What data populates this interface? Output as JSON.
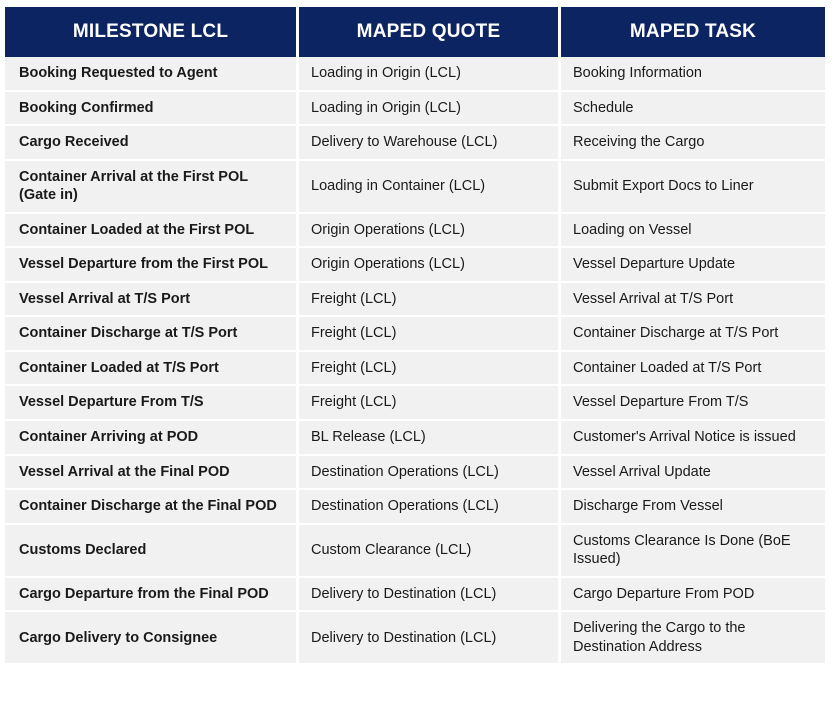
{
  "table": {
    "accent_header_bg": "#0c2461",
    "header_text_color": "#ffffff",
    "row_bg": "#f1f1f1",
    "row_divider_color": "#ffffff",
    "columns": [
      {
        "key": "milestone",
        "label": "MILESTONE LCL"
      },
      {
        "key": "quote",
        "label": "MAPED QUOTE"
      },
      {
        "key": "task",
        "label": "MAPED TASK"
      }
    ],
    "rows": [
      {
        "milestone": "Booking Requested to Agent",
        "quote": "Loading in Origin (LCL)",
        "task": "Booking Information"
      },
      {
        "milestone": "Booking Confirmed",
        "quote": "Loading in Origin (LCL)",
        "task": "Schedule"
      },
      {
        "milestone": "Cargo Received",
        "quote": "Delivery to Warehouse (LCL)",
        "task": "Receiving the Cargo"
      },
      {
        "milestone": "Container Arrival at the First POL (Gate in)",
        "quote": "Loading in Container (LCL)",
        "task": "Submit Export Docs to Liner"
      },
      {
        "milestone": "Container Loaded at the First POL",
        "quote": "Origin Operations (LCL)",
        "task": "Loading on Vessel"
      },
      {
        "milestone": "Vessel Departure from the First POL",
        "quote": "Origin Operations (LCL)",
        "task": "Vessel Departure Update"
      },
      {
        "milestone": "Vessel Arrival at T/S Port",
        "quote": "Freight (LCL)",
        "task": "Vessel Arrival at T/S Port"
      },
      {
        "milestone": "Container Discharge at T/S Port",
        "quote": "Freight (LCL)",
        "task": "Container Discharge at T/S Port"
      },
      {
        "milestone": "Container Loaded at T/S Port",
        "quote": "Freight (LCL)",
        "task": "Container Loaded at T/S Port"
      },
      {
        "milestone": "Vessel Departure From T/S",
        "quote": "Freight (LCL)",
        "task": "Vessel Departure From T/S"
      },
      {
        "milestone": "Container Arriving at POD",
        "quote": "BL Release (LCL)",
        "task": "Customer's Arrival Notice is issued"
      },
      {
        "milestone": "Vessel Arrival at the Final POD",
        "quote": "Destination Operations (LCL)",
        "task": "Vessel Arrival Update"
      },
      {
        "milestone": "Container Discharge at the Final POD",
        "quote": "Destination Operations (LCL)",
        "task": "Discharge From Vessel"
      },
      {
        "milestone": "Customs Declared",
        "quote": "Custom Clearance (LCL)",
        "task": "Customs Clearance Is Done (BoE Issued)"
      },
      {
        "milestone": "Cargo Departure from the Final POD",
        "quote": "Delivery to Destination (LCL)",
        "task": "Cargo Departure From POD"
      },
      {
        "milestone": "Cargo Delivery to Consignee",
        "quote": "Delivery to Destination (LCL)",
        "task": "Delivering the Cargo to the Destination Address"
      }
    ]
  }
}
